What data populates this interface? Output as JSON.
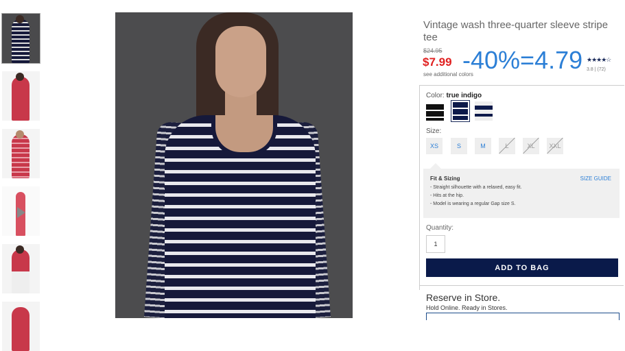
{
  "product": {
    "title": "Vintage wash three-quarter sleeve stripe tee",
    "old_price": "$24.95",
    "sale_price": "$7.99",
    "promo_overlay": "-40%=4.79",
    "see_colors": "see additional colors",
    "stars": "★★★★☆",
    "rating": "3.8 | (72)"
  },
  "color": {
    "label": "Color:",
    "selected": "true indigo"
  },
  "size": {
    "label": "Size:",
    "options": [
      "XS",
      "S",
      "M",
      "L",
      "XL",
      "XXL"
    ]
  },
  "fit": {
    "title": "Fit & Sizing",
    "guide": "SIZE GUIDE",
    "lines": [
      "- Straight silhouette with a relaxed, easy fit.",
      "- Hits at the hip.",
      "- Model is wearing a regular Gap size S."
    ]
  },
  "quantity": {
    "label": "Quantity:",
    "value": "1"
  },
  "add_to_bag": "ADD TO BAG",
  "reserve": {
    "title": "Reserve in Store.",
    "subtitle": "Hold Online. Ready in Stores."
  },
  "colors": {
    "accent": "#2c7fd6",
    "sale": "#e02020",
    "button": "#0a1a4a"
  }
}
